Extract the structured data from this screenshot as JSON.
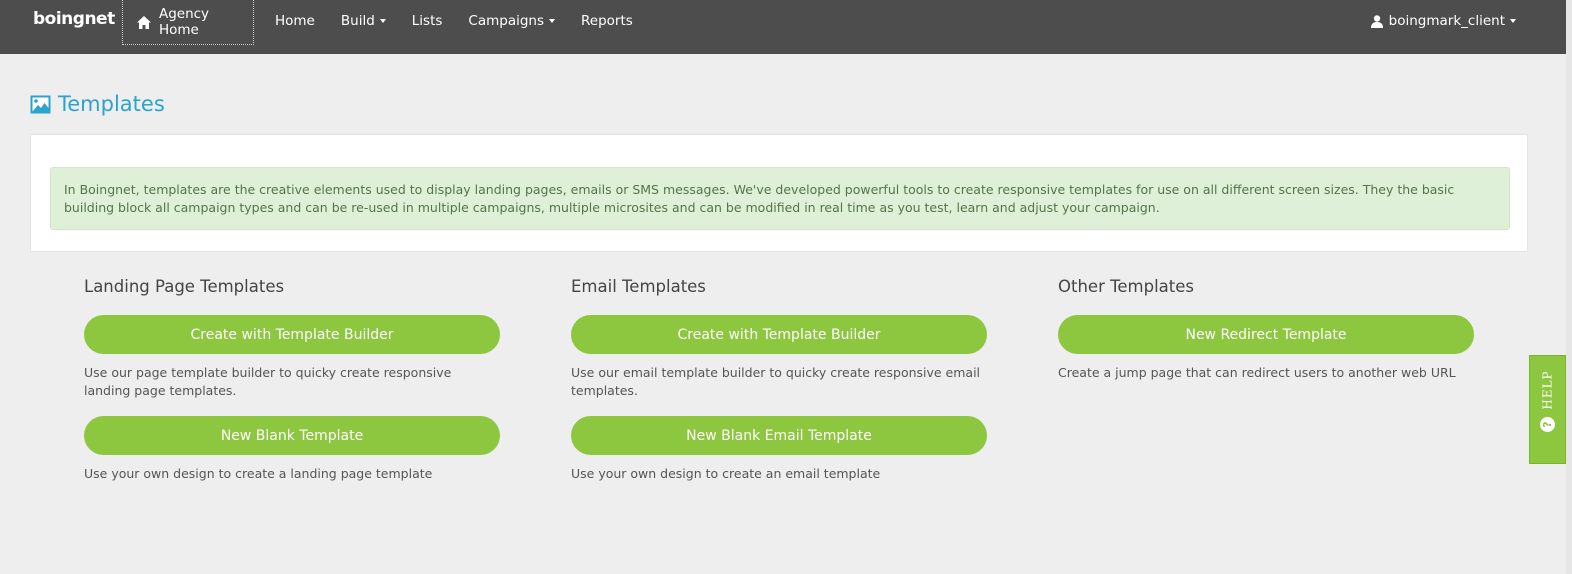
{
  "navbar": {
    "logo": "boingnet",
    "agency_home": "Agency Home",
    "items": [
      {
        "label": "Home",
        "dropdown": false
      },
      {
        "label": "Build",
        "dropdown": true
      },
      {
        "label": "Lists",
        "dropdown": false
      },
      {
        "label": "Campaigns",
        "dropdown": true
      },
      {
        "label": "Reports",
        "dropdown": false
      }
    ],
    "user": "boingmark_client"
  },
  "page": {
    "title": "Templates",
    "info": "In Boingnet, templates are the creative elements used to display landing pages, emails or SMS messages. We've developed powerful tools to create responsive templates for use on all different screen sizes. They the basic building block all campaign types and can be re-used in multiple campaigns, multiple microsites and can be modified in real time as you test, learn and adjust your campaign."
  },
  "columns": {
    "landing": {
      "title": "Landing Page Templates",
      "btn1": "Create with Template Builder",
      "desc1": "Use our page template builder to quicky create responsive landing page templates.",
      "btn2": "New Blank Template",
      "desc2": "Use your own design to create a landing page template"
    },
    "email": {
      "title": "Email Templates",
      "btn1": "Create with Template Builder",
      "desc1": "Use our email template builder to quicky create responsive email templates.",
      "btn2": "New Blank Email Template",
      "desc2": "Use your own design to create an email template"
    },
    "other": {
      "title": "Other Templates",
      "btn1": "New Redirect Template",
      "desc1": "Create a jump page that can redirect users to another web URL"
    }
  },
  "help": {
    "label": "HELP",
    "icon_char": "?"
  },
  "colors": {
    "accent": "#8dc63f",
    "title_blue": "#2aa3cf",
    "navbar": "#4d4d4d",
    "alert_bg": "#dff0d8"
  }
}
